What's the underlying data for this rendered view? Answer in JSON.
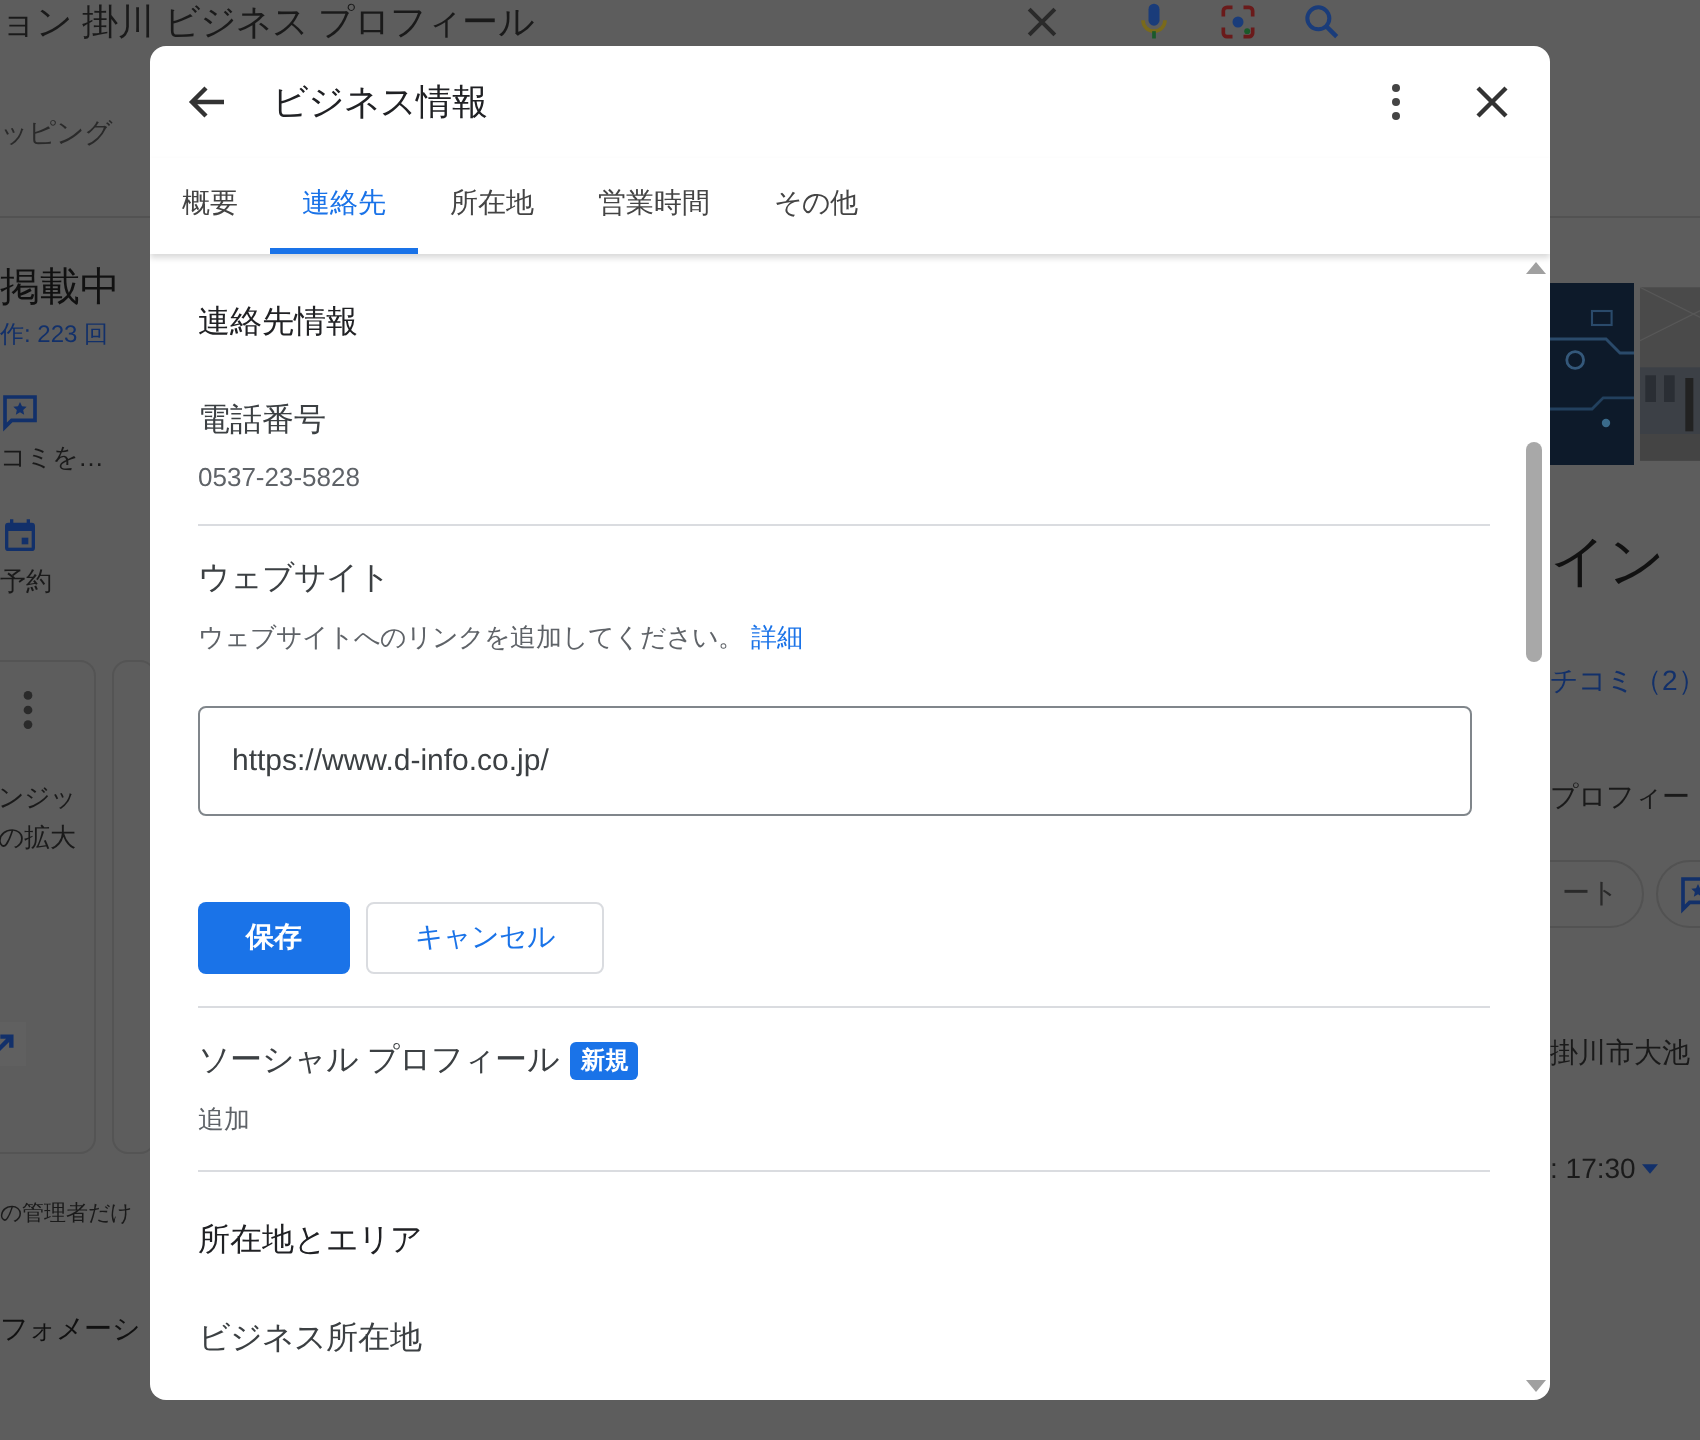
{
  "background": {
    "search": {
      "query": "ョン 掛川 ビジネス プロフィール"
    },
    "nav_tab": "ッピング",
    "left": {
      "heading": "掲載中",
      "views": "作: 223 回",
      "actions": [
        {
          "kind": "review",
          "label": "コミを…"
        },
        {
          "kind": "calendar",
          "label": "予約"
        }
      ],
      "card_lines": [
        "ンジッ",
        "の拡大"
      ],
      "note": "の管理者だけ",
      "section": "フォメーシ"
    },
    "right": {
      "title": "イン",
      "reviews": "チコミ（2）",
      "profile": "プロフィー",
      "chip": "ート",
      "address": "掛川市大池",
      "hours": ": 17:30"
    }
  },
  "dialog": {
    "title": "ビジネス情報",
    "tabs": [
      {
        "label": "概要",
        "selected": false
      },
      {
        "label": "連絡先",
        "selected": true
      },
      {
        "label": "所在地",
        "selected": false
      },
      {
        "label": "営業時間",
        "selected": false
      },
      {
        "label": "その他",
        "selected": false
      }
    ],
    "items": [
      {
        "kind": "heading",
        "text": "連絡先情報"
      },
      {
        "kind": "field",
        "label": "電話番号",
        "value": "0537-23-5828"
      },
      {
        "kind": "editor",
        "label": "ウェブサイト",
        "help": "ウェブサイトへのリンクを追加してください。",
        "link": "詳細",
        "input": "https://www.d-info.co.jp/",
        "buttons": [
          {
            "kind": "primary",
            "label": "保存"
          },
          {
            "kind": "secondary",
            "label": "キャンセル"
          }
        ]
      },
      {
        "kind": "field",
        "label": "ソーシャル プロフィール",
        "badge": "新規",
        "value": "追加"
      },
      {
        "kind": "heading",
        "text": "所在地とエリア"
      },
      {
        "kind": "field",
        "label": "ビジネス所在地"
      }
    ]
  }
}
